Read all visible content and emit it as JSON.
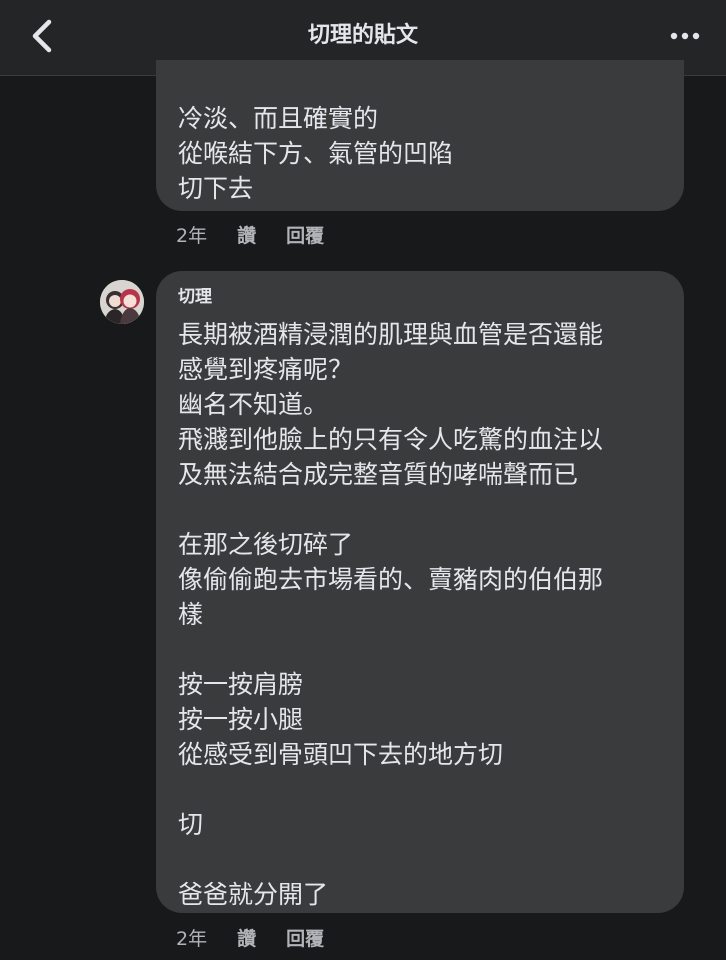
{
  "header": {
    "title": "切理的貼文"
  },
  "comment_1": {
    "lines": [
      "冷淡、而且確實的",
      "從喉結下方、氣管的凹陷",
      "切下去"
    ],
    "meta": {
      "time": "2年",
      "like": "讚",
      "reply": "回覆"
    }
  },
  "comment_2": {
    "author": "切理",
    "lines": [
      "長期被酒精浸潤的肌理與血管是否還能",
      "感覺到疼痛呢？",
      "幽名不知道。",
      "飛濺到他臉上的只有令人吃驚的血注以",
      "及無法結合成完整音質的哮喘聲而已",
      "",
      "在那之後切碎了",
      "像偷偷跑去市場看的、賣豬肉的伯伯那",
      "樣",
      "",
      "按一按肩膀",
      "按一按小腿",
      "從感受到骨頭凹下去的地方切",
      "",
      "切",
      "",
      "爸爸就分開了"
    ],
    "meta": {
      "time": "2年",
      "like": "讚",
      "reply": "回覆"
    }
  },
  "icons": {
    "back": "chevron-left-icon",
    "more": "more-horizontal-icon"
  },
  "colors": {
    "background": "#18191a",
    "header": "#242526",
    "bubble": "#3a3b3c",
    "text": "#e4e6eb",
    "meta_text": "#b0b3b8"
  }
}
